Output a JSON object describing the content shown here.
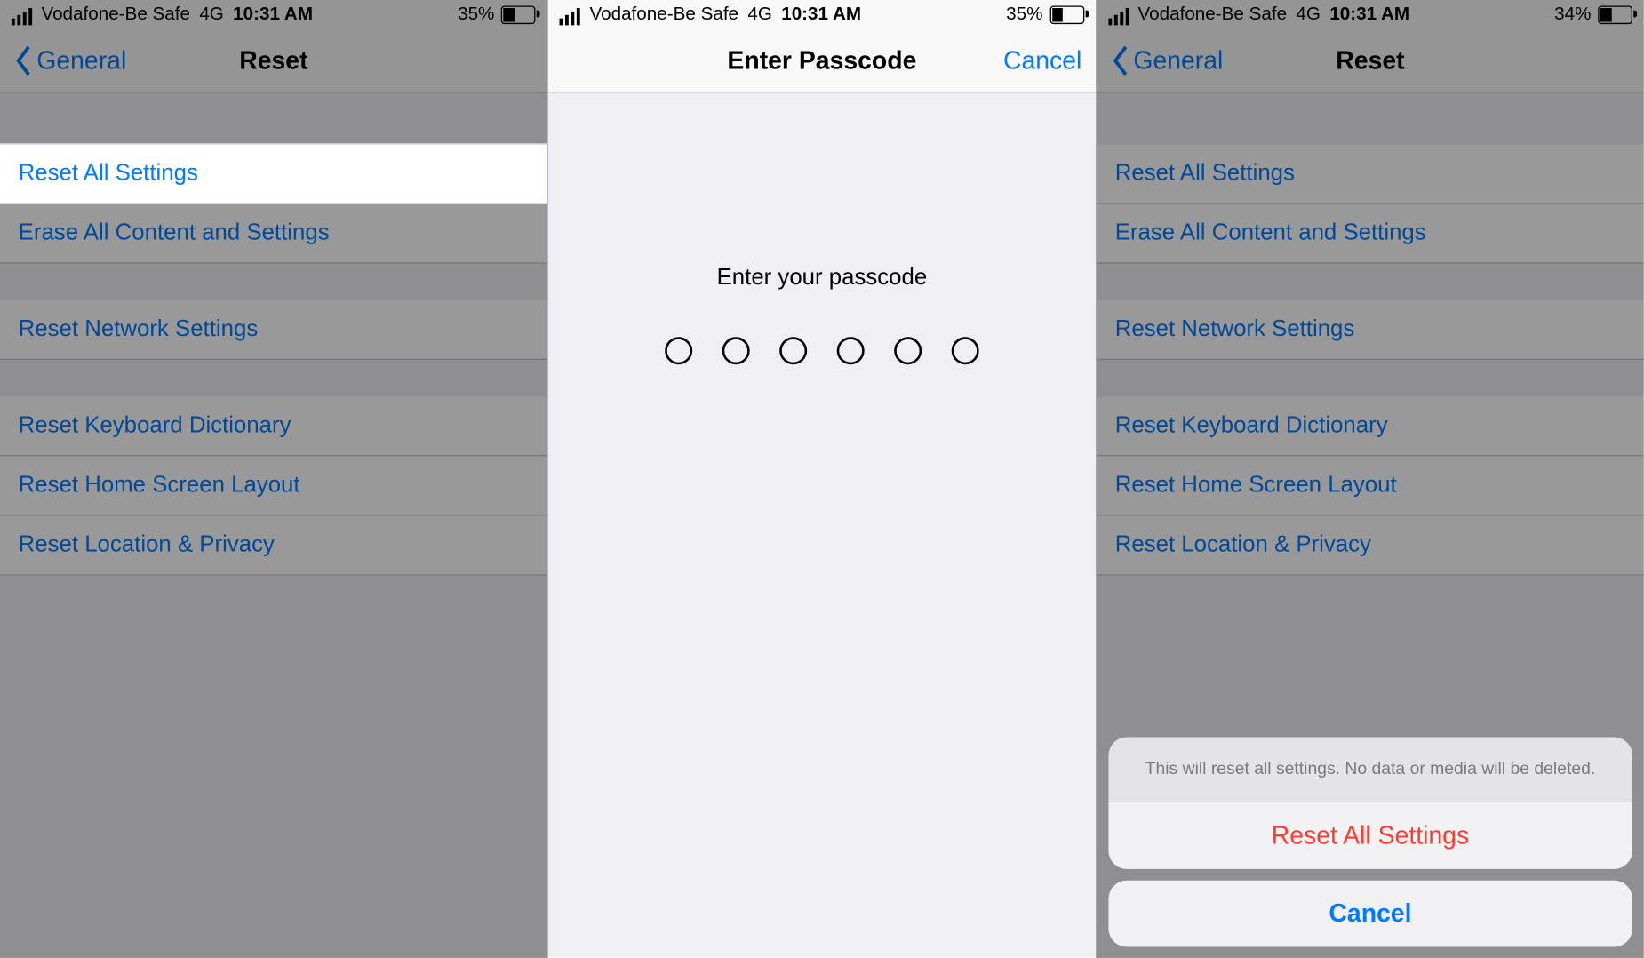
{
  "status": {
    "carrier": "Vodafone-Be Safe",
    "network": "4G",
    "time": "10:31 AM",
    "battery": {
      "screen1": "35%",
      "screen2": "35%",
      "screen3": "34%",
      "fill_pct": 35
    }
  },
  "screen1": {
    "nav_back": "General",
    "nav_title": "Reset",
    "items": [
      "Reset All Settings",
      "Erase All Content and Settings",
      "Reset Network Settings",
      "Reset Keyboard Dictionary",
      "Reset Home Screen Layout",
      "Reset Location & Privacy"
    ]
  },
  "screen2": {
    "nav_title": "Enter Passcode",
    "nav_cancel": "Cancel",
    "prompt": "Enter your passcode",
    "passcode_length": 6
  },
  "screen3": {
    "nav_back": "General",
    "nav_title": "Reset",
    "items": [
      "Reset All Settings",
      "Erase All Content and Settings",
      "Reset Network Settings",
      "Reset Keyboard Dictionary",
      "Reset Home Screen Layout",
      "Reset Location & Privacy"
    ],
    "sheet_message": "This will reset all settings. No data or media will be deleted.",
    "sheet_action": "Reset All Settings",
    "sheet_cancel": "Cancel"
  }
}
